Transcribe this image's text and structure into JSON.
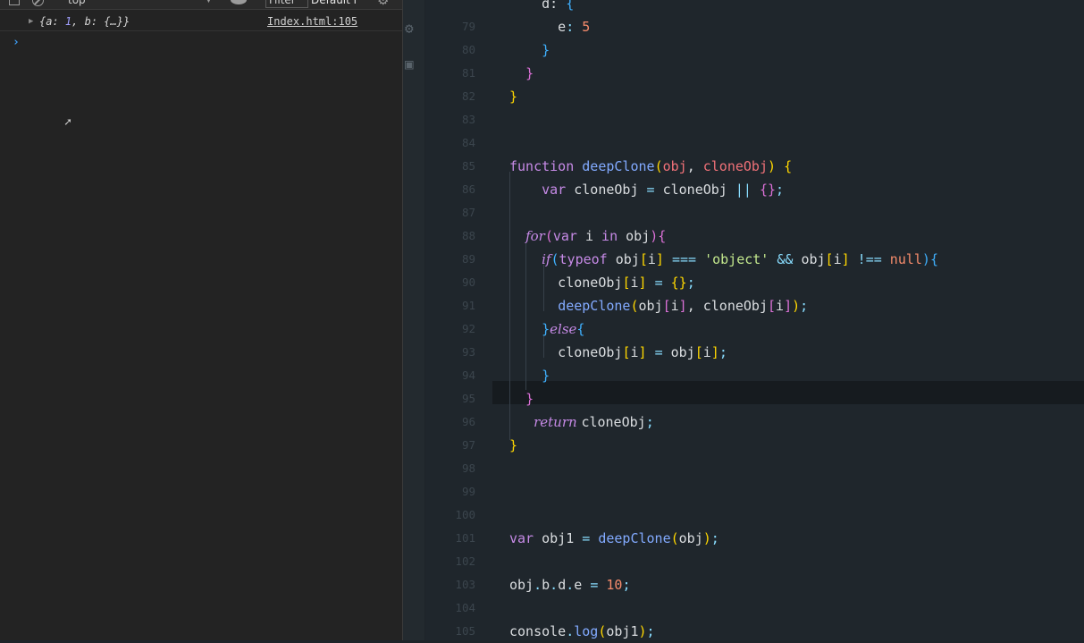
{
  "console": {
    "toolbar": {
      "context": "top",
      "filter_placeholder": "Filter",
      "levels": "Default l"
    },
    "log": {
      "tokens": [
        {
          "t": "{a: "
        },
        {
          "t": "1",
          "c": "num"
        },
        {
          "t": ", b: {…}}"
        }
      ],
      "source_link": "Index.html:105"
    },
    "prompt_symbol": "›"
  },
  "editor": {
    "lines": [
      {
        "n": "",
        "tokens": [
          {
            "t": "    d: ",
            "c": "plain"
          },
          {
            "t": "{",
            "c": "b3"
          }
        ]
      },
      {
        "n": "79",
        "tokens": [
          {
            "t": "      e",
            "c": "prop"
          },
          {
            "t": ": ",
            "c": "op"
          },
          {
            "t": "5",
            "c": "num"
          }
        ]
      },
      {
        "n": "80",
        "tokens": [
          {
            "t": "    ",
            "c": "plain"
          },
          {
            "t": "}",
            "c": "b3"
          }
        ]
      },
      {
        "n": "81",
        "tokens": [
          {
            "t": "  ",
            "c": "plain"
          },
          {
            "t": "}",
            "c": "b2"
          }
        ]
      },
      {
        "n": "82",
        "tokens": [
          {
            "t": "}",
            "c": "b1"
          }
        ]
      },
      {
        "n": "83",
        "tokens": []
      },
      {
        "n": "84",
        "tokens": []
      },
      {
        "n": "85",
        "tokens": [
          {
            "t": "function ",
            "c": "kw"
          },
          {
            "t": "deepClone",
            "c": "fn"
          },
          {
            "t": "(",
            "c": "b1"
          },
          {
            "t": "obj",
            "c": "par"
          },
          {
            "t": ", ",
            "c": "plain"
          },
          {
            "t": "cloneObj",
            "c": "par"
          },
          {
            "t": ") ",
            "c": "b1"
          },
          {
            "t": "{",
            "c": "b1"
          }
        ]
      },
      {
        "n": "86",
        "tokens": [
          {
            "t": "    ",
            "c": "plain"
          },
          {
            "t": "var ",
            "c": "kw"
          },
          {
            "t": "cloneObj ",
            "c": "plain"
          },
          {
            "t": "= ",
            "c": "op"
          },
          {
            "t": "cloneObj ",
            "c": "plain"
          },
          {
            "t": "|| ",
            "c": "op"
          },
          {
            "t": "{}",
            "c": "b2"
          },
          {
            "t": ";",
            "c": "op"
          }
        ]
      },
      {
        "n": "87",
        "tokens": []
      },
      {
        "n": "88",
        "tokens": [
          {
            "t": "  ",
            "c": "plain"
          },
          {
            "t": "for",
            "c": "it"
          },
          {
            "t": "(",
            "c": "b2"
          },
          {
            "t": "var ",
            "c": "kw"
          },
          {
            "t": "i ",
            "c": "plain"
          },
          {
            "t": "in ",
            "c": "kw"
          },
          {
            "t": "obj",
            "c": "plain"
          },
          {
            "t": ")",
            "c": "b2"
          },
          {
            "t": "{",
            "c": "b2"
          }
        ]
      },
      {
        "n": "89",
        "tokens": [
          {
            "t": "    ",
            "c": "plain"
          },
          {
            "t": "if",
            "c": "it"
          },
          {
            "t": "(",
            "c": "b3"
          },
          {
            "t": "typeof ",
            "c": "kw"
          },
          {
            "t": "obj",
            "c": "plain"
          },
          {
            "t": "[",
            "c": "b1"
          },
          {
            "t": "i",
            "c": "plain"
          },
          {
            "t": "] ",
            "c": "b1"
          },
          {
            "t": "=== ",
            "c": "op"
          },
          {
            "t": "'object' ",
            "c": "str"
          },
          {
            "t": "&& ",
            "c": "op"
          },
          {
            "t": "obj",
            "c": "plain"
          },
          {
            "t": "[",
            "c": "b1"
          },
          {
            "t": "i",
            "c": "plain"
          },
          {
            "t": "] ",
            "c": "b1"
          },
          {
            "t": "!== ",
            "c": "op"
          },
          {
            "t": "null",
            "c": "num"
          },
          {
            "t": ")",
            "c": "b3"
          },
          {
            "t": "{",
            "c": "b3"
          }
        ]
      },
      {
        "n": "90",
        "tokens": [
          {
            "t": "      cloneObj",
            "c": "plain"
          },
          {
            "t": "[",
            "c": "b1"
          },
          {
            "t": "i",
            "c": "plain"
          },
          {
            "t": "] ",
            "c": "b1"
          },
          {
            "t": "= ",
            "c": "op"
          },
          {
            "t": "{}",
            "c": "b1"
          },
          {
            "t": ";",
            "c": "op"
          }
        ]
      },
      {
        "n": "91",
        "tokens": [
          {
            "t": "      ",
            "c": "plain"
          },
          {
            "t": "deepClone",
            "c": "fn"
          },
          {
            "t": "(",
            "c": "b1"
          },
          {
            "t": "obj",
            "c": "plain"
          },
          {
            "t": "[",
            "c": "b2"
          },
          {
            "t": "i",
            "c": "plain"
          },
          {
            "t": "]",
            "c": "b2"
          },
          {
            "t": ", ",
            "c": "plain"
          },
          {
            "t": "cloneObj",
            "c": "plain"
          },
          {
            "t": "[",
            "c": "b2"
          },
          {
            "t": "i",
            "c": "plain"
          },
          {
            "t": "]",
            "c": "b2"
          },
          {
            "t": ")",
            "c": "b1"
          },
          {
            "t": ";",
            "c": "op"
          }
        ]
      },
      {
        "n": "92",
        "tokens": [
          {
            "t": "    ",
            "c": "plain"
          },
          {
            "t": "}",
            "c": "b3"
          },
          {
            "t": "else",
            "c": "it"
          },
          {
            "t": "{",
            "c": "b3"
          }
        ]
      },
      {
        "n": "93",
        "tokens": [
          {
            "t": "      cloneObj",
            "c": "plain"
          },
          {
            "t": "[",
            "c": "b1"
          },
          {
            "t": "i",
            "c": "plain"
          },
          {
            "t": "] ",
            "c": "b1"
          },
          {
            "t": "= ",
            "c": "op"
          },
          {
            "t": "obj",
            "c": "plain"
          },
          {
            "t": "[",
            "c": "b1"
          },
          {
            "t": "i",
            "c": "plain"
          },
          {
            "t": "]",
            "c": "b1"
          },
          {
            "t": ";",
            "c": "op"
          }
        ]
      },
      {
        "n": "94",
        "tokens": [
          {
            "t": "    ",
            "c": "plain"
          },
          {
            "t": "}",
            "c": "b3"
          }
        ]
      },
      {
        "n": "95",
        "tokens": [
          {
            "t": "  ",
            "c": "plain"
          },
          {
            "t": "}",
            "c": "b2"
          }
        ]
      },
      {
        "n": "96",
        "tokens": [
          {
            "t": "   ",
            "c": "plain"
          },
          {
            "t": "return ",
            "c": "it"
          },
          {
            "t": "cloneObj",
            "c": "plain"
          },
          {
            "t": ";",
            "c": "op"
          }
        ]
      },
      {
        "n": "97",
        "tokens": [
          {
            "t": "}",
            "c": "b1"
          }
        ]
      },
      {
        "n": "98",
        "tokens": []
      },
      {
        "n": "99",
        "tokens": []
      },
      {
        "n": "100",
        "tokens": []
      },
      {
        "n": "101",
        "tokens": [
          {
            "t": "var ",
            "c": "kw"
          },
          {
            "t": "obj1 ",
            "c": "plain"
          },
          {
            "t": "= ",
            "c": "op"
          },
          {
            "t": "deepClone",
            "c": "fn"
          },
          {
            "t": "(",
            "c": "b1"
          },
          {
            "t": "obj",
            "c": "plain"
          },
          {
            "t": ")",
            "c": "b1"
          },
          {
            "t": ";",
            "c": "op"
          }
        ]
      },
      {
        "n": "102",
        "tokens": []
      },
      {
        "n": "103",
        "tokens": [
          {
            "t": "obj",
            "c": "plain"
          },
          {
            "t": ".",
            "c": "op"
          },
          {
            "t": "b",
            "c": "plain"
          },
          {
            "t": ".",
            "c": "op"
          },
          {
            "t": "d",
            "c": "plain"
          },
          {
            "t": ".",
            "c": "op"
          },
          {
            "t": "e ",
            "c": "plain"
          },
          {
            "t": "= ",
            "c": "op"
          },
          {
            "t": "10",
            "c": "num"
          },
          {
            "t": ";",
            "c": "op"
          }
        ]
      },
      {
        "n": "104",
        "tokens": []
      },
      {
        "n": "105",
        "tokens": [
          {
            "t": "console",
            "c": "plain"
          },
          {
            "t": ".",
            "c": "op"
          },
          {
            "t": "log",
            "c": "fn"
          },
          {
            "t": "(",
            "c": "b1"
          },
          {
            "t": "obj1",
            "c": "plain"
          },
          {
            "t": ")",
            "c": "b1"
          },
          {
            "t": ";",
            "c": "op"
          }
        ]
      }
    ]
  }
}
